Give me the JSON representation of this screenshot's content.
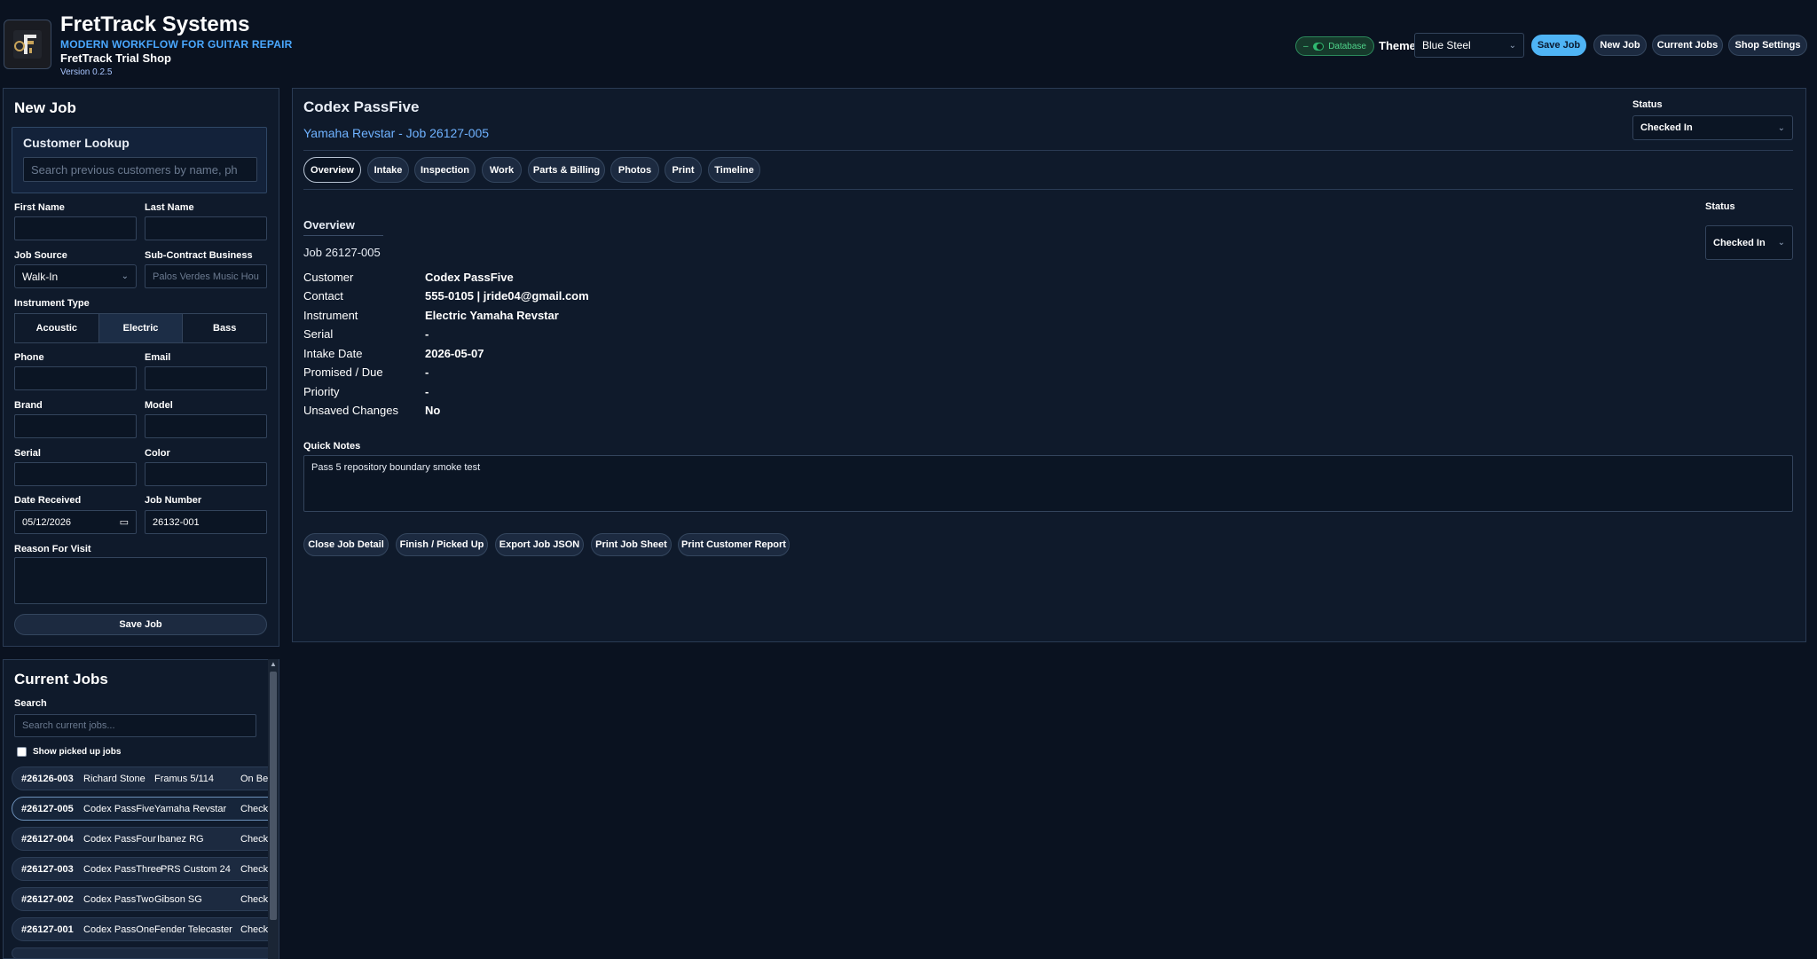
{
  "header": {
    "title": "FretTrack Systems",
    "subtitle": "MODERN WORKFLOW FOR GUITAR REPAIR",
    "shop_name": "FretTrack Trial Shop",
    "version": "Version 0.2.5",
    "database_label": "Database",
    "theme_label": "Theme",
    "theme_value": "Blue Steel",
    "buttons": {
      "save_job": "Save Job",
      "new_job": "New Job",
      "current_jobs": "Current Jobs",
      "shop_settings": "Shop Settings"
    }
  },
  "new_job": {
    "title": "New Job",
    "lookup_title": "Customer Lookup",
    "lookup_placeholder": "Search previous customers by name, ph",
    "first_name_label": "First Name",
    "last_name_label": "Last Name",
    "job_source_label": "Job Source",
    "job_source_value": "Walk-In",
    "subcontract_label": "Sub-Contract Business",
    "subcontract_placeholder": "Palos Verdes Music Hou",
    "instrument_type_label": "Instrument Type",
    "instrument_types": [
      "Acoustic",
      "Electric",
      "Bass"
    ],
    "instrument_type_selected": "Electric",
    "phone_label": "Phone",
    "email_label": "Email",
    "brand_label": "Brand",
    "model_label": "Model",
    "serial_label": "Serial",
    "color_label": "Color",
    "date_received_label": "Date Received",
    "date_received_value": "05/12/2026",
    "job_number_label": "Job Number",
    "job_number_value": "26132-001",
    "reason_label": "Reason For Visit",
    "save_button": "Save Job"
  },
  "current_jobs": {
    "title": "Current Jobs",
    "search_label": "Search",
    "search_placeholder": "Search current jobs...",
    "show_picked_up_label": "Show picked up jobs",
    "jobs": [
      {
        "number": "#26126-003",
        "customer": "Richard Stone",
        "instrument": "Framus 5/114",
        "status": "On Ben"
      },
      {
        "number": "#26127-005",
        "customer": "Codex PassFive",
        "instrument": "Yamaha Revstar",
        "status": "Checke"
      },
      {
        "number": "#26127-004",
        "customer": "Codex PassFour",
        "instrument": "Ibanez RG",
        "status": "Checke"
      },
      {
        "number": "#26127-003",
        "customer": "Codex PassThree",
        "instrument": "PRS Custom 24",
        "status": "Checke"
      },
      {
        "number": "#26127-002",
        "customer": "Codex PassTwo",
        "instrument": "Gibson SG",
        "status": "Checke"
      },
      {
        "number": "#26127-001",
        "customer": "Codex PassOne",
        "instrument": "Fender Telecaster",
        "status": "Checke"
      }
    ]
  },
  "detail": {
    "customer_name": "Codex PassFive",
    "subtitle": "Yamaha Revstar - Job 26127-005",
    "status_label": "Status",
    "status_value": "Checked In",
    "tabs": [
      "Overview",
      "Intake",
      "Inspection",
      "Work",
      "Parts & Billing",
      "Photos",
      "Print",
      "Timeline"
    ],
    "active_tab": "Overview",
    "overview_title": "Overview",
    "job_label": "Job 26127-005",
    "overview_status_label": "Status",
    "overview_status_value": "Checked In",
    "fields": [
      {
        "key": "Customer",
        "value": "Codex PassFive"
      },
      {
        "key": "Contact",
        "value": "555-0105 | jride04@gmail.com"
      },
      {
        "key": "Instrument",
        "value": "Electric Yamaha Revstar"
      },
      {
        "key": "Serial",
        "value": "-"
      },
      {
        "key": "Intake Date",
        "value": "2026-05-07"
      },
      {
        "key": "Promised / Due",
        "value": "-"
      },
      {
        "key": "Priority",
        "value": "-"
      },
      {
        "key": "Unsaved Changes",
        "value": "No"
      }
    ],
    "quick_notes_label": "Quick Notes",
    "quick_notes_value": "Pass 5 repository boundary smoke test",
    "actions": [
      "Close Job Detail",
      "Finish / Picked Up",
      "Export Job JSON",
      "Print Job Sheet",
      "Print Customer Report"
    ]
  }
}
